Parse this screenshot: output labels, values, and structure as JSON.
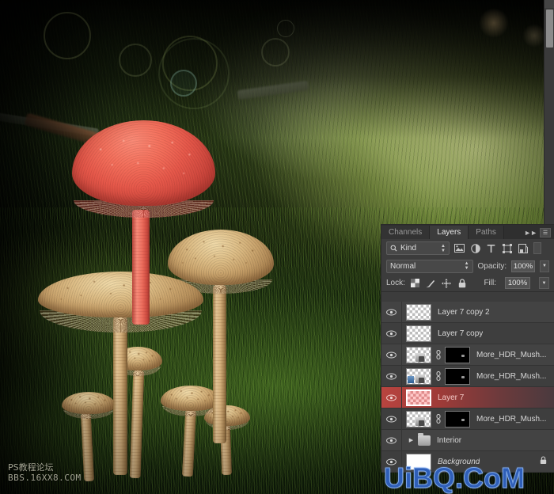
{
  "app": {
    "name": "Adobe Photoshop",
    "document_description": "Photo composite of cream-colored wild mushrooms on a mossy forest bank, the largest cap recolored bright red"
  },
  "canvas": {
    "scrollbar": {
      "name": "vertical-scrollbar",
      "position_percent": 6
    }
  },
  "panel": {
    "tabs": [
      {
        "label": "Channels",
        "active": false
      },
      {
        "label": "Layers",
        "active": true
      },
      {
        "label": "Paths",
        "active": false
      }
    ],
    "collapse_label": "▶▶",
    "menu_label": "≡",
    "filter": {
      "kind_label": "Kind",
      "search_icon": "search-icon",
      "type_filters": [
        {
          "name": "filter-pixel-layers-icon",
          "title": "Pixel layers"
        },
        {
          "name": "filter-adjustment-layers-icon",
          "title": "Adjustment layers"
        },
        {
          "name": "filter-type-layers-icon",
          "title": "Type layers"
        },
        {
          "name": "filter-shape-layers-icon",
          "title": "Shape layers"
        },
        {
          "name": "filter-smart-objects-icon",
          "title": "Smart objects"
        }
      ],
      "toggle_name": "filter-enable-toggle"
    },
    "blend": {
      "mode": "Normal",
      "opacity_label": "Opacity:",
      "opacity_value": "100%",
      "fill_label": "Fill:",
      "fill_value": "100%"
    },
    "lock": {
      "label": "Lock:",
      "items": [
        {
          "name": "lock-transparent-pixels-icon",
          "title": "Lock transparent pixels"
        },
        {
          "name": "lock-image-pixels-icon",
          "title": "Lock image pixels"
        },
        {
          "name": "lock-position-icon",
          "title": "Lock position"
        },
        {
          "name": "lock-all-icon",
          "title": "Lock all"
        }
      ]
    },
    "layers": [
      {
        "name": "Layer 7 copy 2",
        "visible": true,
        "selected": false,
        "kind": "pixel",
        "has_mask": false,
        "italic": false,
        "thumb": "empty"
      },
      {
        "name": "Layer 7 copy",
        "visible": true,
        "selected": false,
        "kind": "pixel",
        "has_mask": false,
        "italic": false,
        "thumb": "empty"
      },
      {
        "name": "More_HDR_Mush...",
        "visible": true,
        "selected": false,
        "kind": "pixel",
        "has_mask": true,
        "italic": false,
        "thumb": "content"
      },
      {
        "name": "More_HDR_Mush...",
        "visible": true,
        "selected": false,
        "kind": "pixel",
        "has_mask": true,
        "italic": false,
        "thumb": "content"
      },
      {
        "name": "Layer 7",
        "visible": true,
        "selected": true,
        "kind": "pixel",
        "has_mask": false,
        "italic": false,
        "thumb": "red"
      },
      {
        "name": "More_HDR_Mush...",
        "visible": true,
        "selected": false,
        "kind": "pixel",
        "has_mask": true,
        "italic": false,
        "thumb": "content"
      },
      {
        "name": "Interior",
        "visible": true,
        "selected": false,
        "kind": "group",
        "has_mask": false,
        "italic": false,
        "thumb": "folder"
      },
      {
        "name": "Background",
        "visible": true,
        "selected": false,
        "kind": "background",
        "has_mask": false,
        "italic": true,
        "thumb": "white",
        "locked": true
      }
    ]
  },
  "watermarks": {
    "bottom_left_line1": "PS教程论坛",
    "bottom_left_line2": "BBS.16XX8.COM",
    "bottom_right": "UiBQ.CoM"
  },
  "colors": {
    "panel_bg": "#3c3c3c",
    "panel_row": "#434343",
    "selected_layer": "#b8443f",
    "text": "#d7d7d7",
    "watermark_blue": "#2f5fb8",
    "red_mushroom": "#ee6353"
  }
}
